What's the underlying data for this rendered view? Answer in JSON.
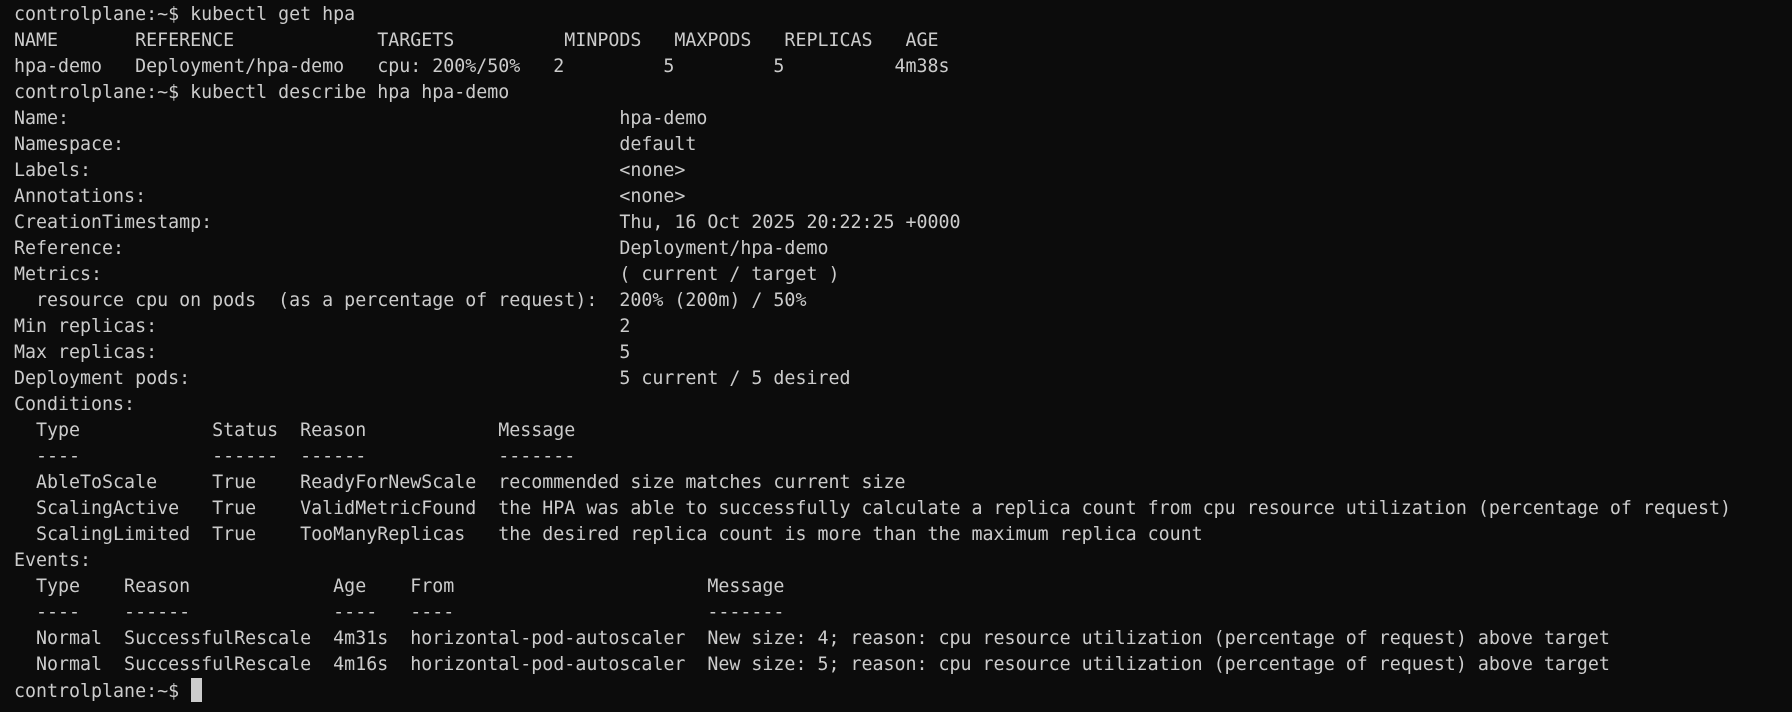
{
  "terminal": {
    "lines": [
      "controlplane:~$ kubectl get hpa",
      "NAME       REFERENCE             TARGETS          MINPODS   MAXPODS   REPLICAS   AGE",
      "hpa-demo   Deployment/hpa-demo   cpu: 200%/50%   2         5         5          4m38s",
      "controlplane:~$ kubectl describe hpa hpa-demo",
      "Name:                                                  hpa-demo",
      "Namespace:                                             default",
      "Labels:                                                <none>",
      "Annotations:                                           <none>",
      "CreationTimestamp:                                     Thu, 16 Oct 2025 20:22:25 +0000",
      "Reference:                                             Deployment/hpa-demo",
      "Metrics:                                               ( current / target )",
      "  resource cpu on pods  (as a percentage of request):  200% (200m) / 50%",
      "Min replicas:                                          2",
      "Max replicas:                                          5",
      "Deployment pods:                                       5 current / 5 desired",
      "Conditions:",
      "  Type            Status  Reason            Message",
      "  ----            ------  ------            -------",
      "  AbleToScale     True    ReadyForNewScale  recommended size matches current size",
      "  ScalingActive   True    ValidMetricFound  the HPA was able to successfully calculate a replica count from cpu resource utilization (percentage of request)",
      "  ScalingLimited  True    TooManyReplicas   the desired replica count is more than the maximum replica count",
      "Events:",
      "  Type    Reason             Age    From                       Message",
      "  ----    ------             ----   ----                       -------",
      "  Normal  SuccessfulRescale  4m31s  horizontal-pod-autoscaler  New size: 4; reason: cpu resource utilization (percentage of request) above target",
      "  Normal  SuccessfulRescale  4m16s  horizontal-pod-autoscaler  New size: 5; reason: cpu resource utilization (percentage of request) above target"
    ],
    "prompt": "controlplane:~$ "
  }
}
